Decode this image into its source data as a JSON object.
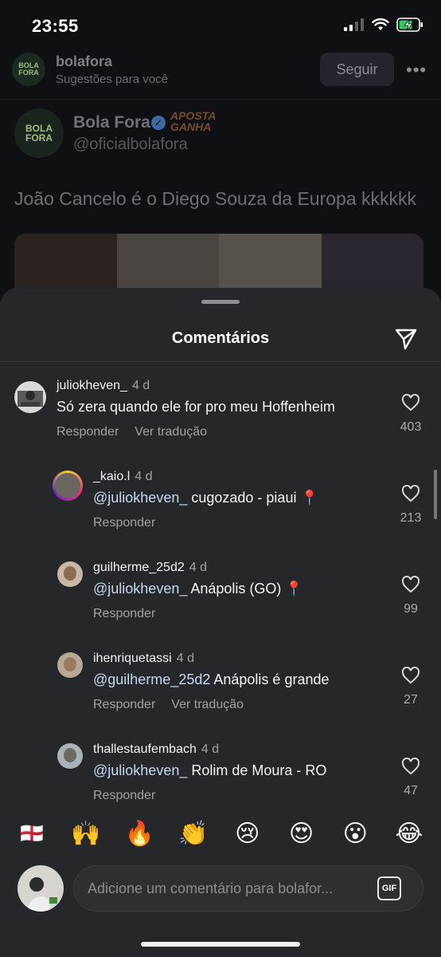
{
  "status": {
    "time": "23:55"
  },
  "post": {
    "username": "bolafora",
    "subtitle": "Sugestões para você",
    "follow_label": "Seguir",
    "more_label": "•••",
    "logo_text": "BOLA FORA",
    "tweet": {
      "name": "Bola Fora",
      "sponsor": "APOSTA GANHA",
      "handle": "@oficialbolafora",
      "text": "João Cancelo é o Diego Souza da Europa kkkkkk"
    }
  },
  "sheet": {
    "title": "Comentários",
    "comments": [
      {
        "user": "juliokheven_",
        "age": "4 d",
        "mention": "",
        "text": "Só zera quando ele for pro meu Hoffenheim",
        "reply": "Responder",
        "translate": "Ver tradução",
        "likes": "403"
      },
      {
        "user": "_kaio.l",
        "age": "4 d",
        "mention": "@juliokheven_",
        "text": " cugozado - piaui 📍",
        "reply": "Responder",
        "translate": "",
        "likes": "213"
      },
      {
        "user": "guilherme_25d2",
        "age": "4 d",
        "mention": "@juliokheven_",
        "text": " Anápolis (GO) 📍",
        "reply": "Responder",
        "translate": "",
        "likes": "99"
      },
      {
        "user": "ihenriquetassi",
        "age": "4 d",
        "mention": "@guilherme_25d2",
        "text": " Anápolis é grande",
        "reply": "Responder",
        "translate": "Ver tradução",
        "likes": "27"
      },
      {
        "user": "thallestaufembach",
        "age": "4 d",
        "mention": "@juliokheven_",
        "text": " Rolim de Moura - RO",
        "reply": "Responder",
        "translate": "",
        "likes": "47"
      }
    ],
    "emojis": [
      "🏴󠁧󠁢󠁥󠁮󠁧󠁿",
      "🙌",
      "🔥",
      "👏",
      "😢",
      "😍",
      "😮",
      "😂"
    ],
    "input_placeholder": "Adicione um comentário para bolafor...",
    "gif_label": "GIF"
  }
}
